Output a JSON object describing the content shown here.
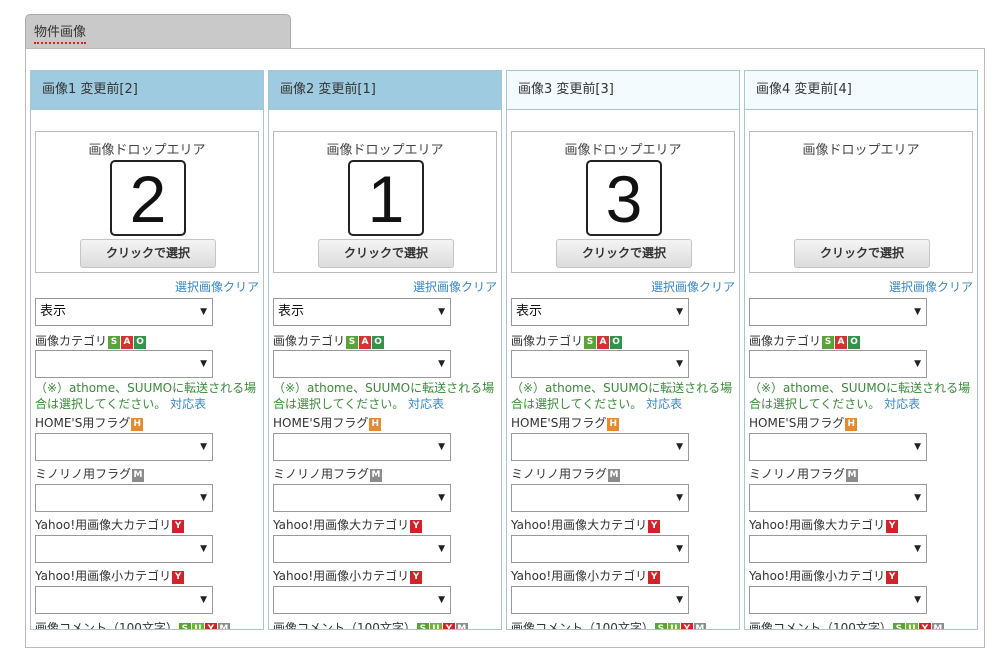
{
  "tab": {
    "label": "物件画像"
  },
  "texts": {
    "drop_area": "画像ドロップエリア",
    "pick_button": "クリックで選択",
    "clear_link": "選択画像クリア",
    "category_label": "画像カテゴリ",
    "note_text": "（※）athome、SUUMOに転送される場合は選択してください。",
    "note_link": "対応表",
    "homes_flag": "HOME'S用フラグ",
    "minorino_flag": "ミノリノ用フラグ",
    "yahoo_large": "Yahoo!用画像大カテゴリ",
    "yahoo_small": "Yahoo!用画像小カテゴリ",
    "comment": "画像コメント（100文字）"
  },
  "badges": {
    "s": "S",
    "a": "A",
    "o": "O",
    "h": "H",
    "m": "M",
    "y": "Y",
    "u": "U"
  },
  "columns": [
    {
      "header": "画像1 変更前[2]",
      "number": "2",
      "display": "表示",
      "style": "active"
    },
    {
      "header": "画像2 変更前[1]",
      "number": "1",
      "display": "表示",
      "style": "active"
    },
    {
      "header": "画像3 変更前[3]",
      "number": "3",
      "display": "表示",
      "style": "inactive"
    },
    {
      "header": "画像4 変更前[4]",
      "number": "",
      "display": "",
      "style": "inactive"
    }
  ]
}
